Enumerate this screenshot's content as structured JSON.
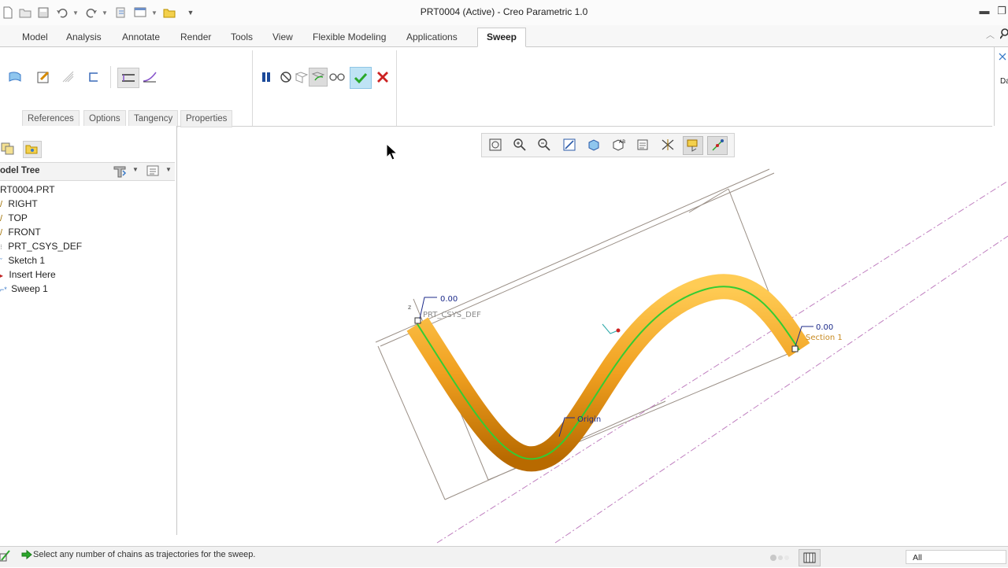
{
  "window": {
    "title": "PRT0004 (Active) - Creo Parametric 1.0"
  },
  "tabs": [
    {
      "label": "Model"
    },
    {
      "label": "Analysis"
    },
    {
      "label": "Annotate"
    },
    {
      "label": "Render"
    },
    {
      "label": "Tools"
    },
    {
      "label": "View"
    },
    {
      "label": "Flexible Modeling"
    },
    {
      "label": "Applications"
    },
    {
      "label": "Sweep"
    }
  ],
  "sweep_subtabs": [
    {
      "label": "References"
    },
    {
      "label": "Options"
    },
    {
      "label": "Tangency"
    },
    {
      "label": "Properties"
    }
  ],
  "right_strip_label": "Da",
  "model_tree": {
    "title": "odel Tree",
    "items": [
      {
        "label": "RT0004.PRT"
      },
      {
        "label": "RIGHT"
      },
      {
        "label": "TOP"
      },
      {
        "label": "FRONT"
      },
      {
        "label": "PRT_CSYS_DEF"
      },
      {
        "label": "Sketch 1"
      },
      {
        "label": "Insert Here"
      },
      {
        "label": "Sweep 1"
      }
    ]
  },
  "viewport": {
    "csys_label": "PRT_CSYS_DEF",
    "start_value": "0.00",
    "end_value": "0.00",
    "section_label": "Section 1",
    "origin_label": "Origin",
    "axis_z": "z"
  },
  "status": {
    "message": "Select any number of chains as trajectories for the sweep.",
    "filter_value": "All"
  },
  "colors": {
    "tube": "#f0a020",
    "trajectory": "#33cc33",
    "confirm": "#2aa82a",
    "cancel": "#cc2222"
  }
}
